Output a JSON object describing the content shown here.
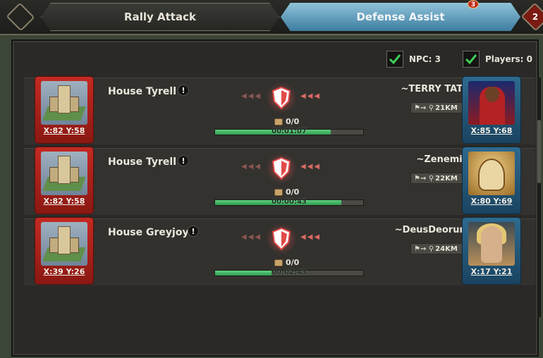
{
  "tabs": {
    "rally_label": "Rally Attack",
    "defense_label": "Defense Assist",
    "defense_badge": "3"
  },
  "corner_badge": "2",
  "filters": {
    "npc_label": "NPC: 3",
    "players_label": "Players: 0",
    "npc_checked": true,
    "players_checked": true
  },
  "rows": [
    {
      "house": "House Tyrell",
      "home_coords": "X:82 Y:58",
      "troops": "0/0",
      "timer": "00:01:07",
      "progress": 0.78,
      "player": "~TERRY TATE",
      "distance": "21KM",
      "player_coords": "X:85 Y:68"
    },
    {
      "house": "House Tyrell",
      "home_coords": "X:82 Y:58",
      "troops": "0/0",
      "timer": "00:00:43",
      "progress": 0.85,
      "player": "~Zenemig",
      "distance": "22KM",
      "player_coords": "X:80 Y:69"
    },
    {
      "house": "House Greyjoy",
      "home_coords": "X:39 Y:26",
      "troops": "0/0",
      "timer": "00:02:43",
      "progress": 0.38,
      "player": "~DeusDeorum",
      "distance": "24KM",
      "player_coords": "X:17 Y:21"
    }
  ],
  "icons": {
    "check": "check-icon",
    "info": "info-icon",
    "shield": "shield-icon",
    "flag": "flag-icon",
    "box": "box-icon"
  },
  "colors": {
    "accent_blue": "#5fa3c8",
    "home_red": "#c42a22",
    "player_blue": "#2e6a8f",
    "progress_green": "#2e9c50",
    "check_green": "#3fcf57"
  }
}
